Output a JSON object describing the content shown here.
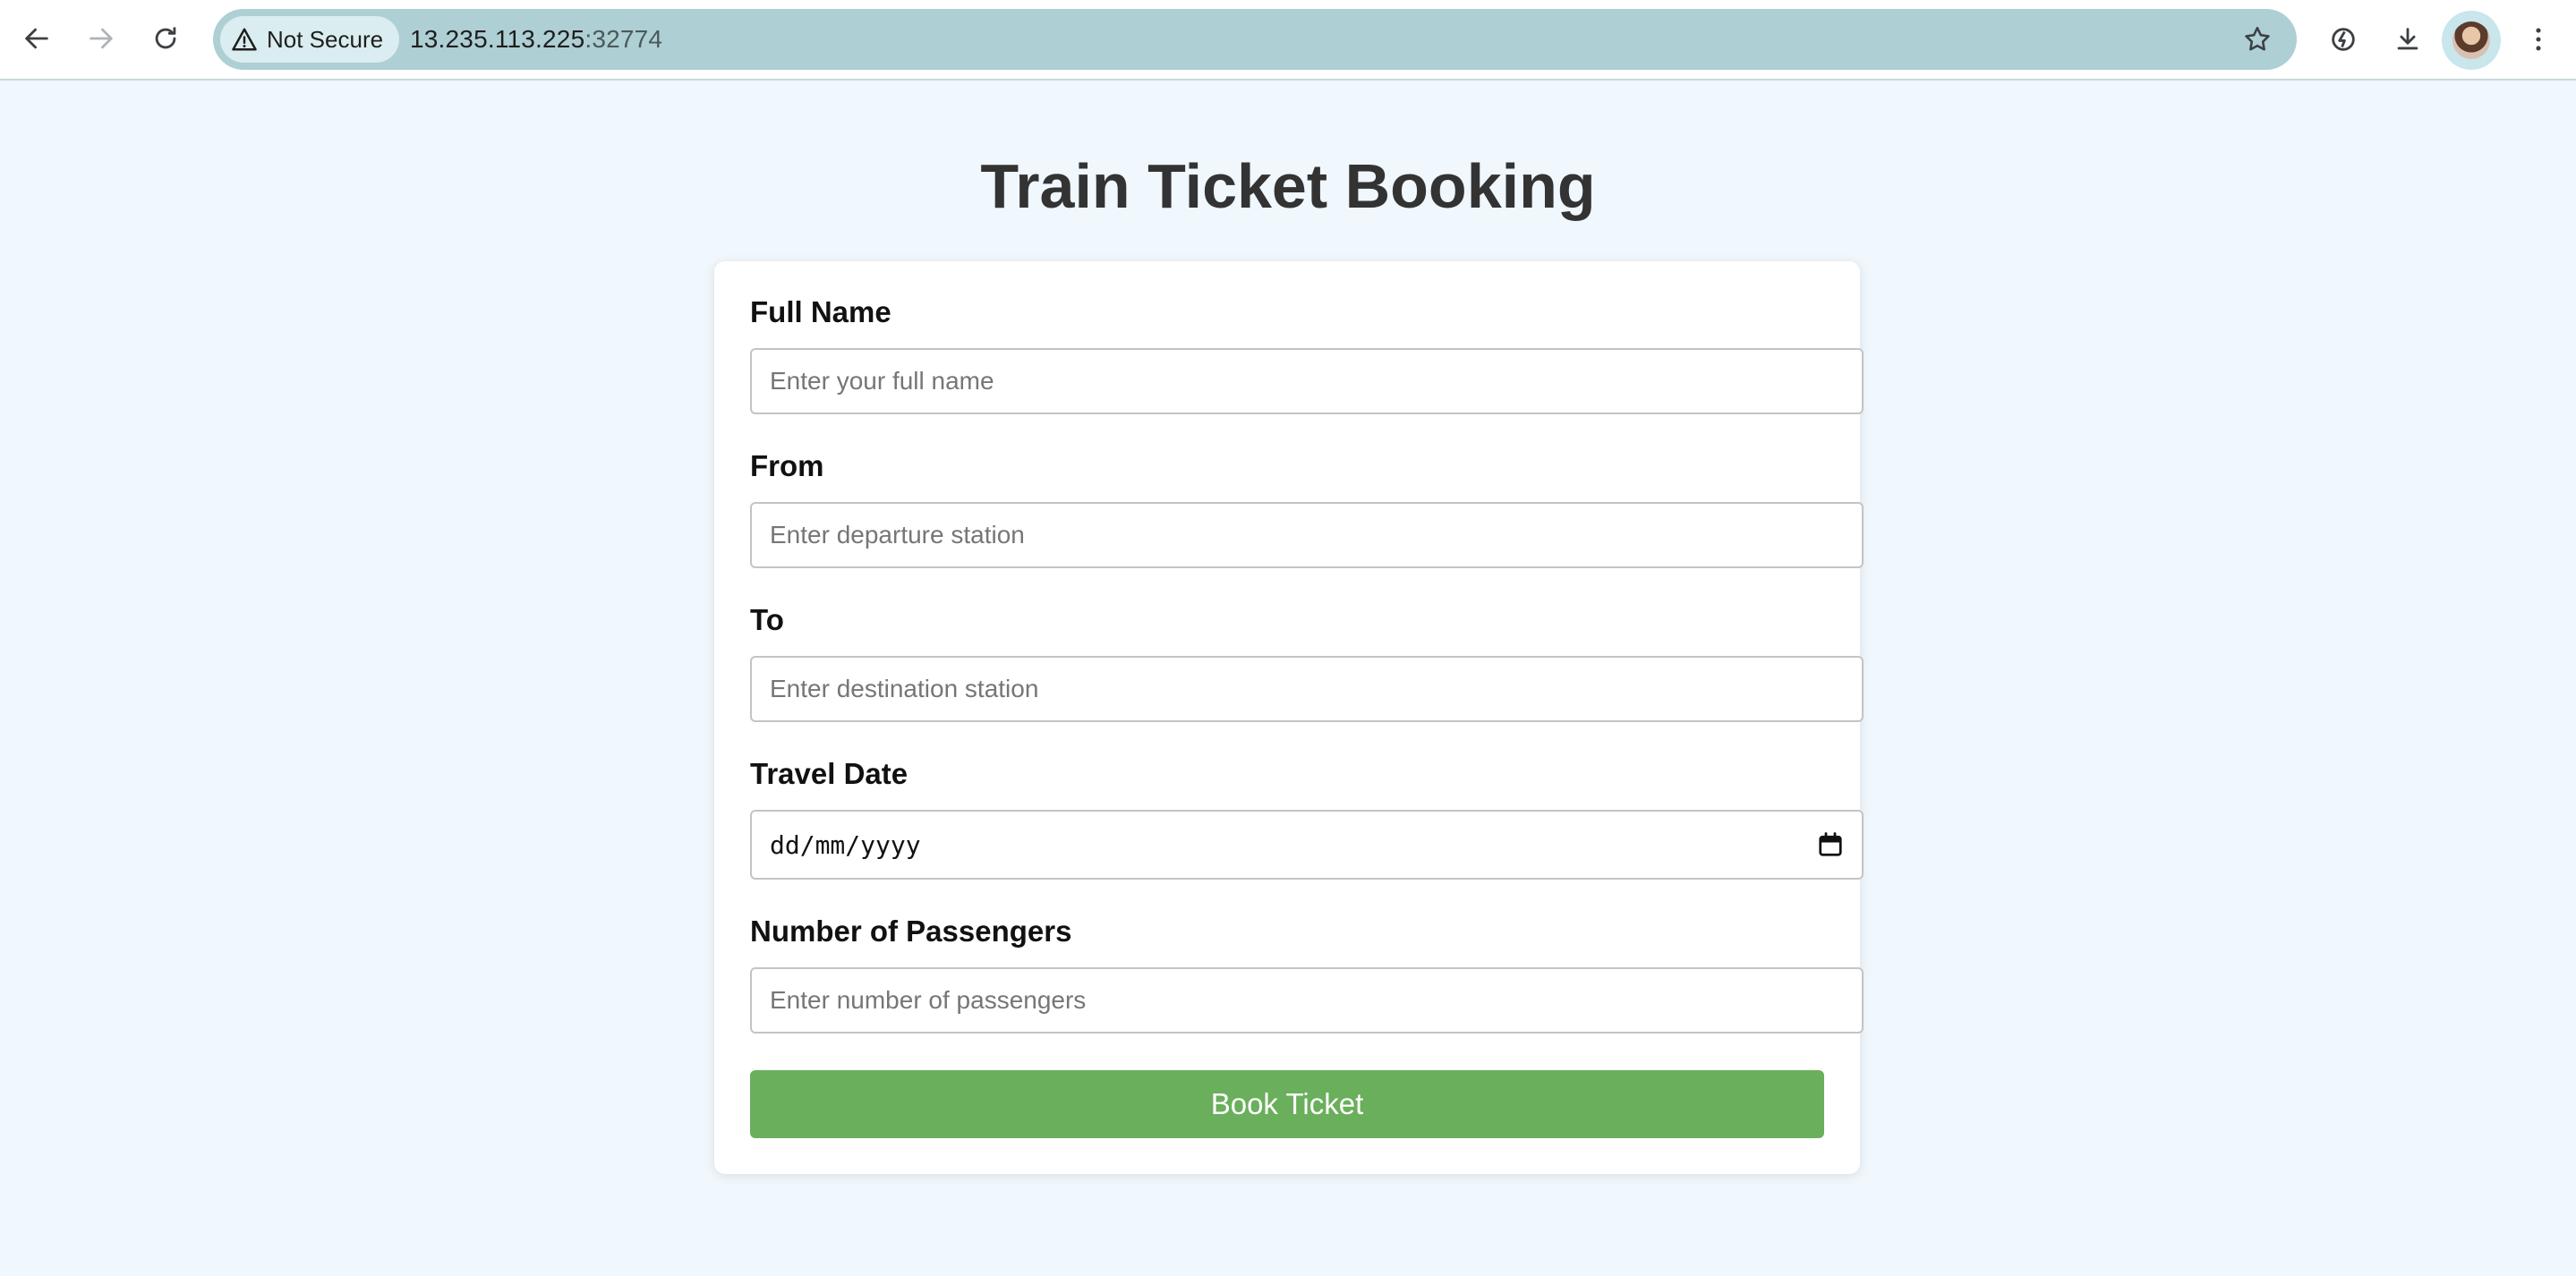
{
  "browser": {
    "security_label": "Not Secure",
    "url_host": "13.235.113.225",
    "url_port": ":32774",
    "icons": [
      "back-arrow-icon",
      "forward-arrow-icon",
      "reload-icon",
      "warning-triangle-icon",
      "star-icon",
      "performance-icon",
      "download-icon",
      "profile-avatar",
      "kebab-menu-icon"
    ]
  },
  "page": {
    "title": "Train Ticket Booking"
  },
  "form": {
    "full_name": {
      "label": "Full Name",
      "placeholder": "Enter your full name",
      "value": ""
    },
    "from": {
      "label": "From",
      "placeholder": "Enter departure station",
      "value": ""
    },
    "to": {
      "label": "To",
      "placeholder": "Enter destination station",
      "value": ""
    },
    "travel_date": {
      "label": "Travel Date",
      "display": "dd/mm/yyyy"
    },
    "passengers": {
      "label": "Number of Passengers",
      "placeholder": "Enter number of passengers",
      "value": ""
    },
    "submit_label": "Book Ticket"
  },
  "colors": {
    "page_background": "#f0f7fd",
    "omnibox": "#aecfd3",
    "button": "#6aaf5c",
    "title_text": "#333333"
  }
}
